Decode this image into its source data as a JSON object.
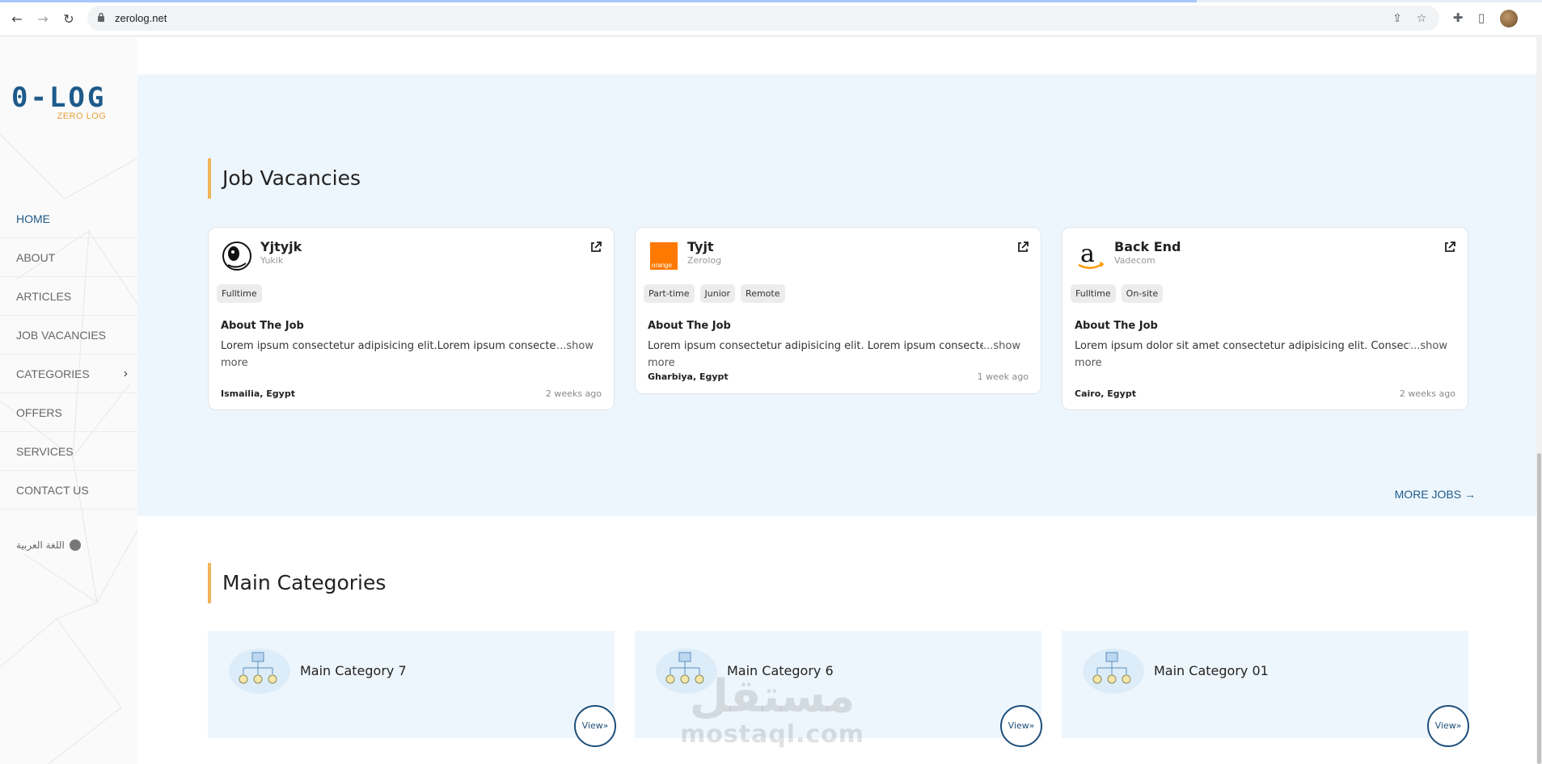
{
  "browser": {
    "url": "zerolog.net"
  },
  "sidebar": {
    "logo_main": "0-LOG",
    "logo_sub": "ZERO LOG",
    "menu": [
      {
        "label": "HOME"
      },
      {
        "label": "ABOUT"
      },
      {
        "label": "ARTICLES"
      },
      {
        "label": "JOB VACANCIES"
      },
      {
        "label": "CATEGORIES"
      },
      {
        "label": "OFFERS"
      },
      {
        "label": "SERVICES"
      },
      {
        "label": "CONTACT US"
      }
    ],
    "language": "اللغة العربية"
  },
  "jobs": {
    "title": "Job Vacancies",
    "about_label": "About The Job",
    "more_label": "MORE JOBS",
    "items": [
      {
        "title": "Yjtyjk",
        "company": "Yukik",
        "tags": [
          "Fulltime"
        ],
        "desc": "Lorem ipsum consectetur adipisicing elit.Lorem ipsum consectetur",
        "more": "...show more",
        "location": "Ismailia, Egypt",
        "posted": "2 weeks ago"
      },
      {
        "title": "Tyjt",
        "company": "Zerolog",
        "tags": [
          "Part-time",
          "Junior",
          "Remote"
        ],
        "desc": "Lorem ipsum consectetur adipisicing elit. Lorem ipsum consectetur",
        "more": "...show more",
        "location": "Gharbiya, Egypt",
        "posted": "1 week ago"
      },
      {
        "title": "Back End",
        "company": "Vadecom",
        "tags": [
          "Fulltime",
          "On-site"
        ],
        "desc": "Lorem ipsum dolor sit amet consectetur adipisicing elit. Consectetur",
        "more": "...show more",
        "location": "Cairo, Egypt",
        "posted": "2 weeks ago"
      }
    ]
  },
  "categories": {
    "title": "Main Categories",
    "view_label": "View»",
    "items": [
      {
        "name": "Main Category 7"
      },
      {
        "name": "Main Category 6"
      },
      {
        "name": "Main Category 01"
      }
    ]
  },
  "watermark": {
    "arabic": "مستقل",
    "latin": "mostaql.com"
  },
  "colors": {
    "brand": "#1e5a8a",
    "accent": "#f0b45a",
    "section_bg": "#eef6fd"
  }
}
